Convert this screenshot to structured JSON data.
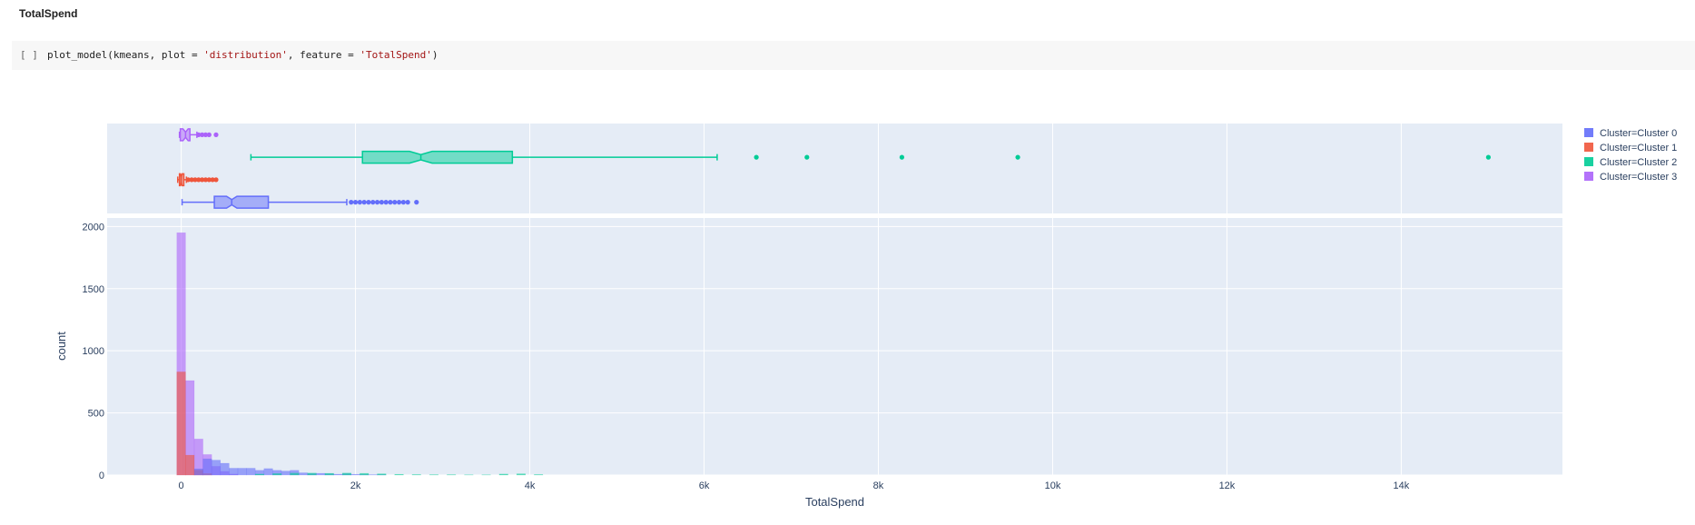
{
  "heading": "TotalSpend",
  "cell": {
    "prompt": "[ ]",
    "code_prefix": "plot_model(kmeans, plot = ",
    "plot_arg": "'distribution'",
    "code_mid": ", feature = ",
    "feature_arg": "'TotalSpend'",
    "code_suffix": ")"
  },
  "colors": {
    "Cluster 0": "#636efa",
    "Cluster 1": "#ef553b",
    "Cluster 2": "#00cc96",
    "Cluster 3": "#ab63fa",
    "plot_bg": "#e5ecf6",
    "grid": "#ffffff",
    "text": "#2a3f5f"
  },
  "chart_data": {
    "type": "histogram + box (marginal)",
    "xlabel": "TotalSpend",
    "ylabel": "count",
    "xlim": [
      -850,
      15850
    ],
    "ylim": [
      0,
      2010
    ],
    "x_ticks": [
      {
        "value": 0,
        "label": "0"
      },
      {
        "value": 2000,
        "label": "2k"
      },
      {
        "value": 4000,
        "label": "4k"
      },
      {
        "value": 6000,
        "label": "6k"
      },
      {
        "value": 8000,
        "label": "8k"
      },
      {
        "value": 10000,
        "label": "10k"
      },
      {
        "value": 12000,
        "label": "12k"
      },
      {
        "value": 14000,
        "label": "14k"
      }
    ],
    "y_ticks": [
      {
        "value": 0,
        "label": "0"
      },
      {
        "value": 500,
        "label": "500"
      },
      {
        "value": 1000,
        "label": "1000"
      },
      {
        "value": 1500,
        "label": "1500"
      },
      {
        "value": 2000,
        "label": "2000"
      }
    ],
    "grid": true,
    "legend_position": "right",
    "legend": [
      {
        "name": "Cluster=Cluster 0",
        "cluster": "Cluster 0"
      },
      {
        "name": "Cluster=Cluster 1",
        "cluster": "Cluster 1"
      },
      {
        "name": "Cluster=Cluster 2",
        "cluster": "Cluster 2"
      },
      {
        "name": "Cluster=Cluster 3",
        "cluster": "Cluster 3"
      }
    ],
    "bin_width": 100,
    "histogram": [
      {
        "cluster": "Cluster 3",
        "bins": [
          [
            -50,
            1950
          ],
          [
            50,
            760
          ],
          [
            150,
            290
          ],
          [
            250,
            165
          ],
          [
            350,
            70
          ],
          [
            450,
            30
          ],
          [
            550,
            8
          ]
        ]
      },
      {
        "cluster": "Cluster 1",
        "bins": [
          [
            -50,
            830
          ],
          [
            50,
            160
          ],
          [
            150,
            40
          ],
          [
            250,
            12
          ]
        ]
      },
      {
        "cluster": "Cluster 0",
        "bins": [
          [
            150,
            50
          ],
          [
            250,
            130
          ],
          [
            350,
            120
          ],
          [
            450,
            95
          ],
          [
            550,
            55
          ],
          [
            650,
            55
          ],
          [
            750,
            55
          ],
          [
            850,
            38
          ],
          [
            950,
            52
          ],
          [
            1050,
            38
          ],
          [
            1150,
            32
          ],
          [
            1250,
            38
          ],
          [
            1350,
            18
          ],
          [
            1450,
            12
          ],
          [
            1550,
            14
          ],
          [
            1650,
            10
          ],
          [
            1750,
            7
          ],
          [
            1850,
            11
          ],
          [
            1950,
            6
          ],
          [
            2050,
            4
          ],
          [
            2150,
            3
          ],
          [
            2250,
            3
          ]
        ]
      },
      {
        "cluster": "Cluster 2",
        "bins": [
          [
            850,
            8
          ],
          [
            1050,
            12
          ],
          [
            1250,
            16
          ],
          [
            1450,
            16
          ],
          [
            1650,
            14
          ],
          [
            1850,
            16
          ],
          [
            2050,
            14
          ],
          [
            2250,
            10
          ],
          [
            2450,
            6
          ],
          [
            2650,
            4
          ],
          [
            2850,
            3
          ],
          [
            3050,
            3
          ],
          [
            3250,
            2
          ],
          [
            3450,
            2
          ],
          [
            3650,
            8
          ],
          [
            3850,
            10
          ],
          [
            4050,
            4
          ]
        ]
      }
    ],
    "boxes": [
      {
        "cluster": "Cluster 3",
        "min": -20,
        "q1": -10,
        "median": 50,
        "q3": 100,
        "max": 180,
        "notch": [
          20,
          80
        ],
        "outliers": [
          200,
          240,
          280,
          320,
          400
        ]
      },
      {
        "cluster": "Cluster 2",
        "min": 800,
        "q1": 2080,
        "median": 2750,
        "q3": 3800,
        "max": 6150,
        "notch": [
          2620,
          2880
        ],
        "outliers": [
          6600,
          7180,
          8270,
          9600,
          15000
        ]
      },
      {
        "cluster": "Cluster 1",
        "min": -40,
        "q1": -20,
        "median": 0,
        "q3": 30,
        "max": 60,
        "notch": [
          -10,
          10
        ],
        "outliers": [
          80,
          120,
          160,
          200,
          240,
          280,
          320,
          360,
          400
        ]
      },
      {
        "cluster": "Cluster 0",
        "min": 10,
        "q1": 380,
        "median": 580,
        "q3": 1000,
        "max": 1900,
        "notch": [
          520,
          640
        ],
        "outliers": [
          1950,
          2000,
          2050,
          2100,
          2150,
          2200,
          2250,
          2300,
          2350,
          2400,
          2450,
          2500,
          2550,
          2600,
          2700
        ]
      }
    ]
  }
}
